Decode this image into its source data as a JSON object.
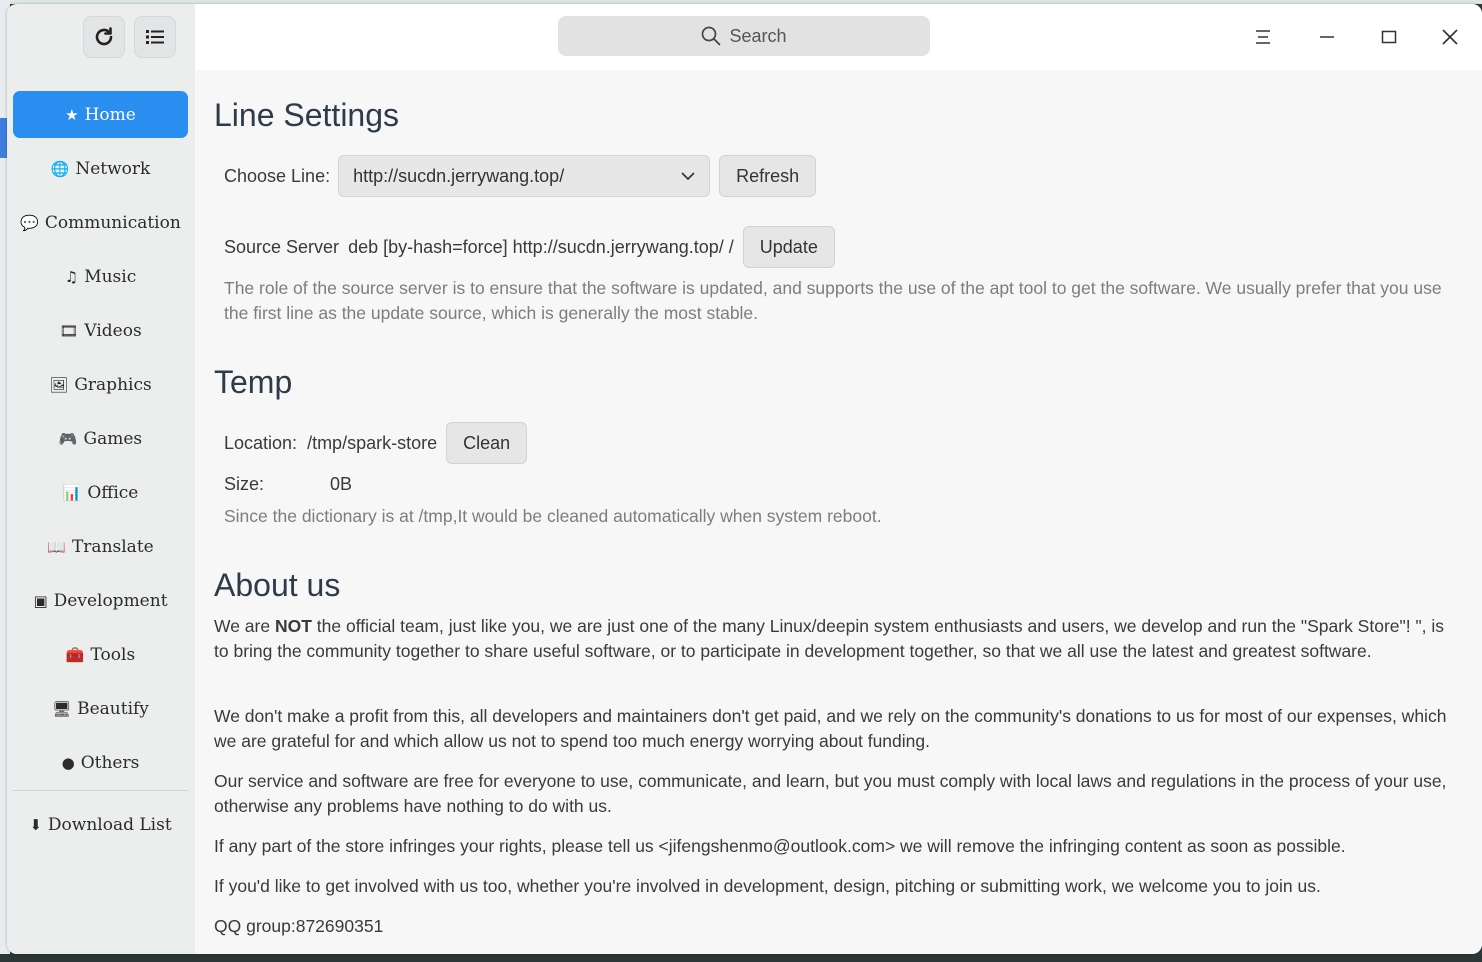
{
  "sidebar": {
    "items": [
      {
        "label": "Home",
        "icon": "star-icon",
        "glyph": "★",
        "active": true
      },
      {
        "label": "Network",
        "icon": "globe-icon",
        "glyph": "🌐",
        "active": false
      },
      {
        "label": "Communication",
        "icon": "chat-icon",
        "glyph": "💬",
        "active": false
      },
      {
        "label": "Music",
        "icon": "music-note-icon",
        "glyph": "♫",
        "active": false
      },
      {
        "label": "Videos",
        "icon": "film-icon",
        "glyph": "🎞",
        "active": false
      },
      {
        "label": "Graphics",
        "icon": "image-icon",
        "glyph": "🖼",
        "active": false
      },
      {
        "label": "Games",
        "icon": "gamepad-icon",
        "glyph": "🎮",
        "active": false
      },
      {
        "label": "Office",
        "icon": "presentation-icon",
        "glyph": "📊",
        "active": false
      },
      {
        "label": "Translate",
        "icon": "book-icon",
        "glyph": "📖",
        "active": false
      },
      {
        "label": "Development",
        "icon": "terminal-icon",
        "glyph": "▣",
        "active": false
      },
      {
        "label": "Tools",
        "icon": "toolbox-icon",
        "glyph": "🧰",
        "active": false
      },
      {
        "label": "Beautify",
        "icon": "monitor-icon",
        "glyph": "🖥",
        "active": false
      },
      {
        "label": "Others",
        "icon": "ellipsis-circle-icon",
        "glyph": "●",
        "active": false
      }
    ],
    "download": {
      "label": "Download List",
      "icon": "download-icon",
      "glyph": "⬇"
    }
  },
  "search": {
    "placeholder": "Search"
  },
  "line_settings": {
    "title": "Line Settings",
    "choose_label": "Choose Line:",
    "selected_line": "http://sucdn.jerrywang.top/",
    "refresh_label": "Refresh",
    "source_label": "Source Server",
    "source_value": "deb [by-hash=force] http://sucdn.jerrywang.top/ /",
    "update_label": "Update",
    "description": "The role of the source server is to ensure that the software is updated, and supports the use of the apt tool to get the software. We usually prefer that you use the first line as the update source, which is generally the most stable."
  },
  "temp": {
    "title": "Temp",
    "location_label": "Location:",
    "location_value": "/tmp/spark-store",
    "clean_label": "Clean",
    "size_label": "Size:",
    "size_value": "0B",
    "note": "Since the dictionary is at /tmp,It would be cleaned automatically when  system reboot."
  },
  "about": {
    "title": "About us",
    "p1_pre": "We are ",
    "p1_bold": "NOT",
    "p1_post": " the official team, just like you, we are just one of the many Linux/deepin system enthusiasts and users, we develop and run the \"Spark Store\"! \", is to bring the community together to share useful software, or to participate in development together, so that we all use the latest and greatest software.",
    "p2": "We don't make a profit from this, all developers and maintainers don't get paid, and we rely on the community's donations to us for most of our expenses, which we are grateful for and which allow us not to spend too much energy worrying about funding.",
    "p3": "Our service and software are free for everyone to use, communicate, and learn, but you must comply with local laws and regulations in the process of your use, otherwise any problems have nothing to do with us.",
    "p4": "If any part of the store infringes your rights, please tell us <jifengshenmo@outlook.com> we will remove the infringing content as soon as possible.",
    "p5": "If you'd like to get involved with us too, whether you're involved in development, design, pitching or submitting work, we welcome you to join us.",
    "p6": "QQ group:872690351"
  },
  "colors": {
    "accent": "#2a8ef0",
    "sidebar_bg": "#eceeee",
    "content_bg": "#f7f7f7"
  }
}
